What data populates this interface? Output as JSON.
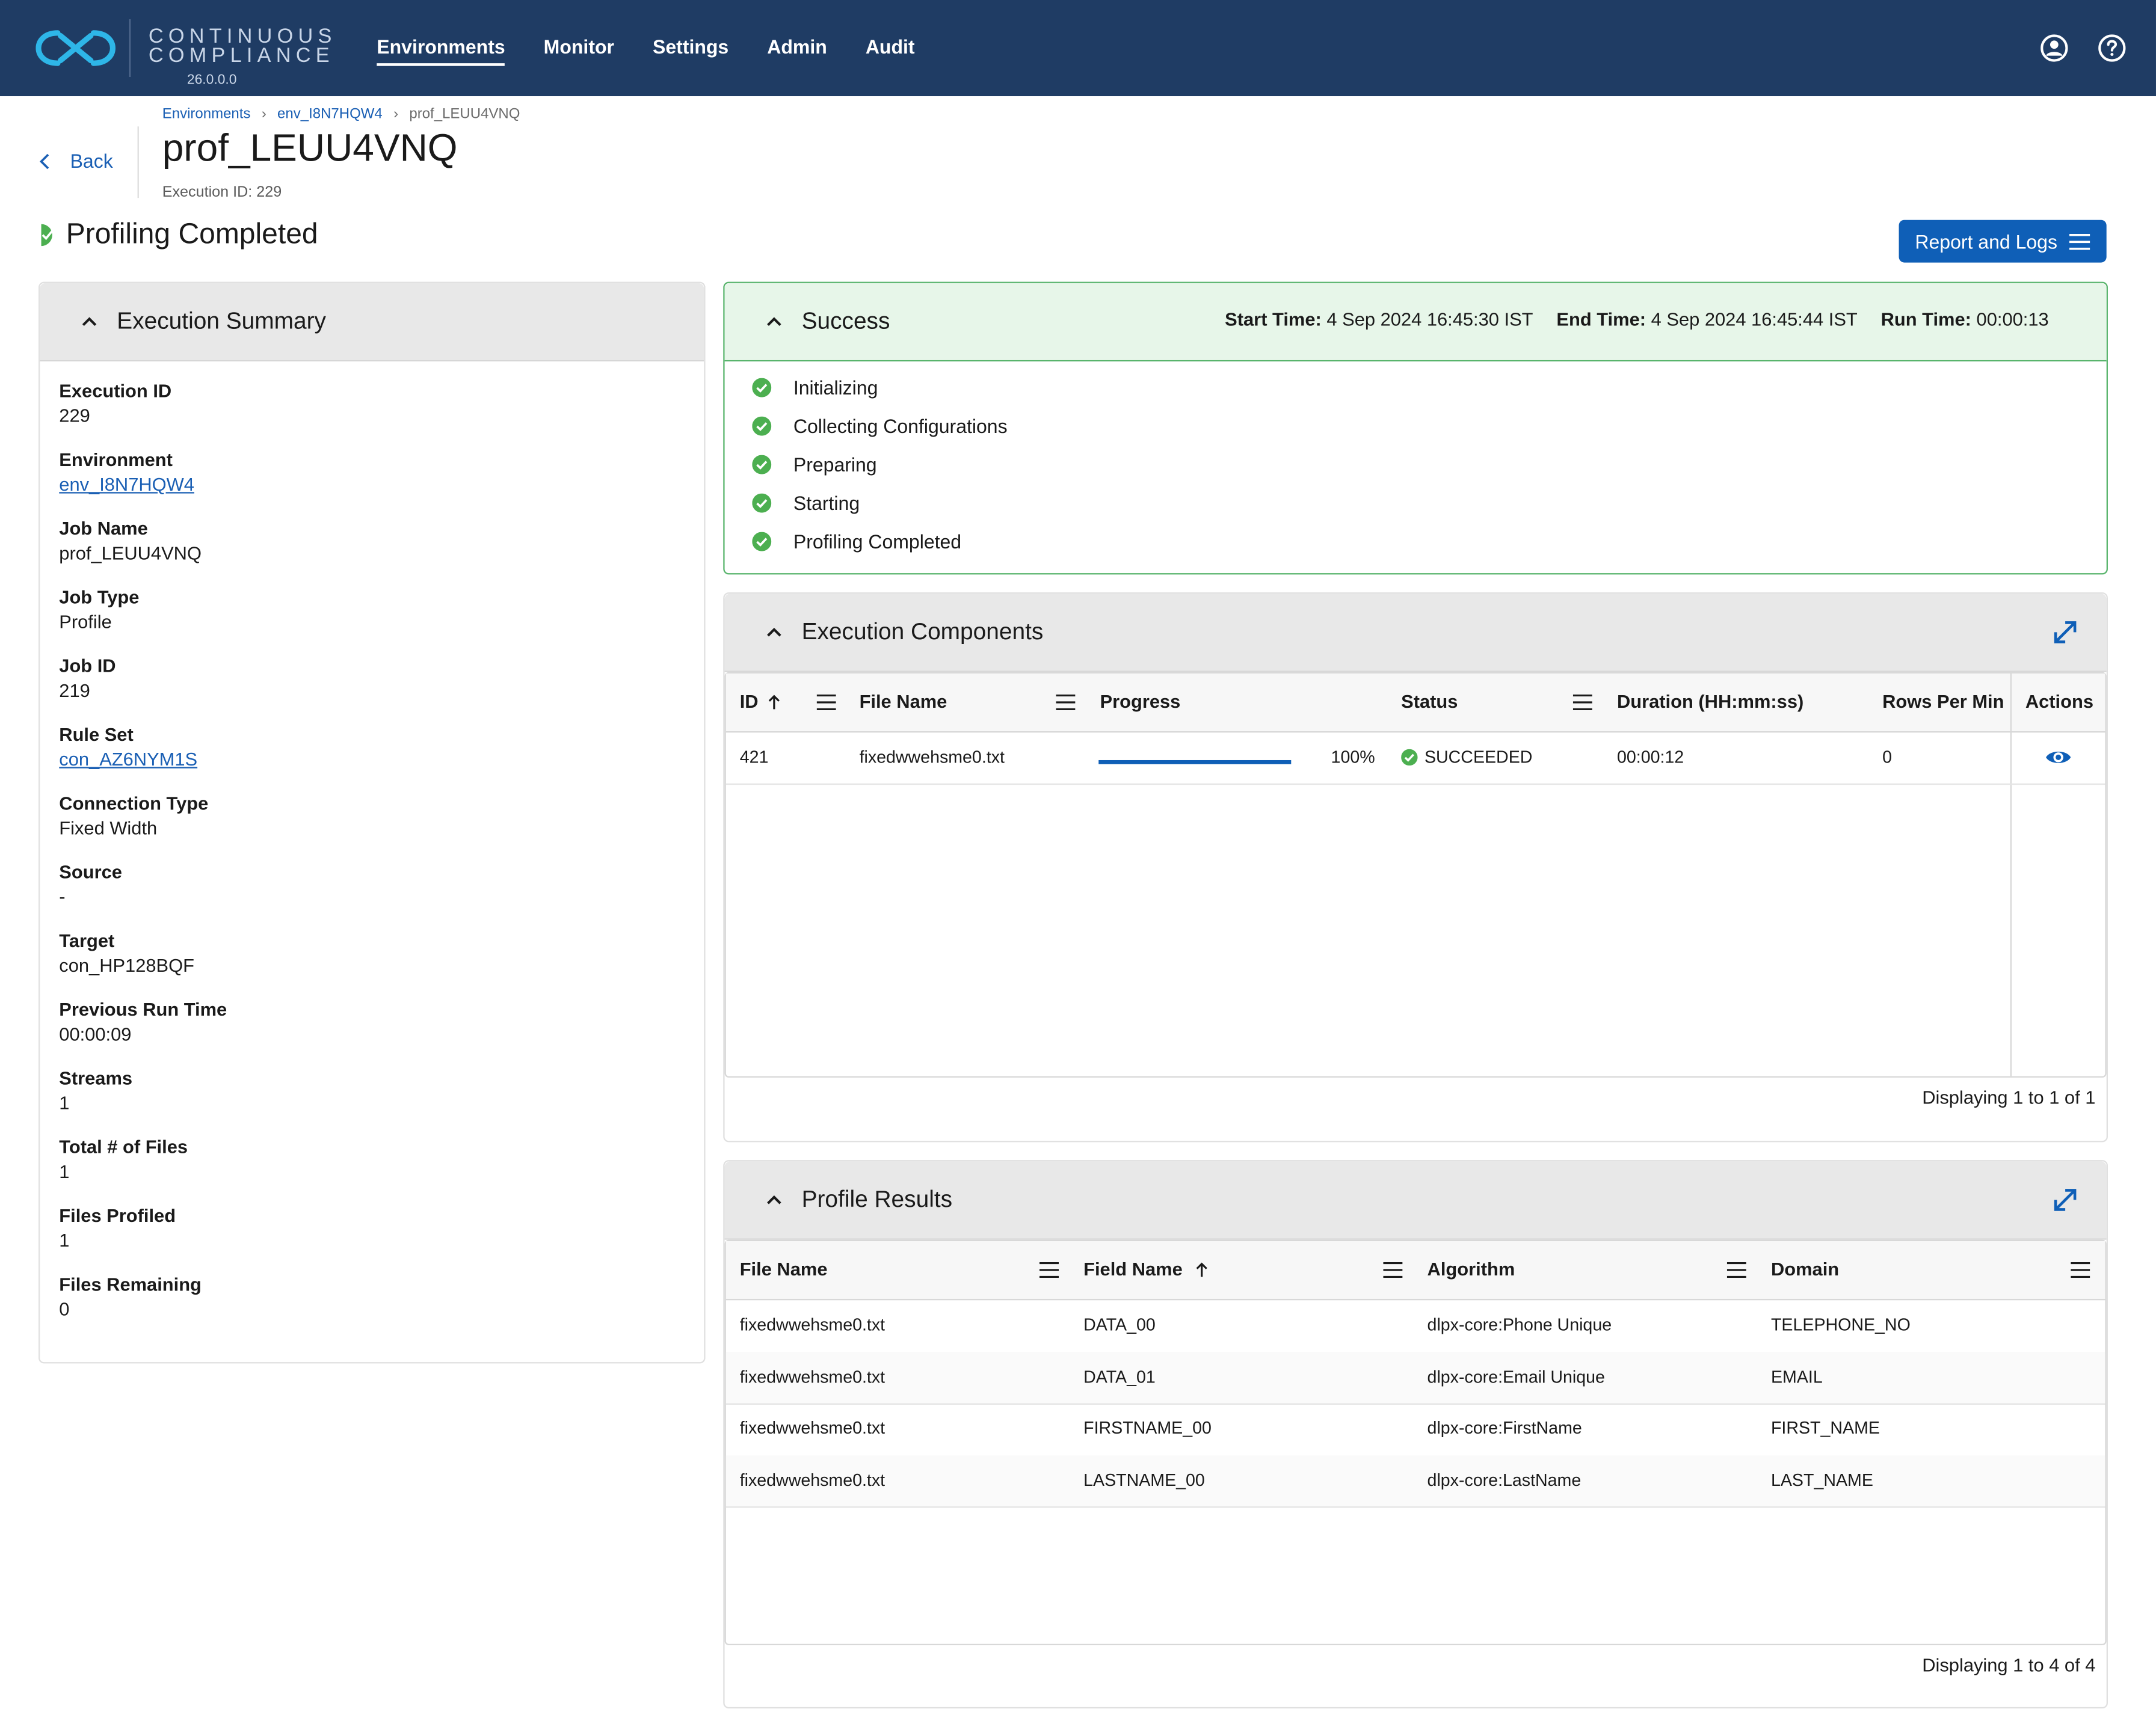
{
  "brand": {
    "line1": "CONTINUOUS",
    "line2": "COMPLIANCE",
    "version": "26.0.0.0"
  },
  "nav": {
    "items": [
      "Environments",
      "Monitor",
      "Settings",
      "Admin",
      "Audit"
    ],
    "active": "Environments"
  },
  "breadcrumb": [
    "Environments",
    "env_I8N7HQW4",
    "prof_LEUU4VNQ"
  ],
  "back_label": "Back",
  "page_title": "prof_LEUU4VNQ",
  "execution_id_sub": "Execution ID: 229",
  "status_heading": "Profiling Completed",
  "report_button": "Report and Logs",
  "summary": {
    "title": "Execution Summary",
    "fields": [
      {
        "label": "Execution ID",
        "value": "229"
      },
      {
        "label": "Environment",
        "value": "env_I8N7HQW4"
      },
      {
        "label": "Job Name",
        "value": "prof_LEUU4VNQ"
      },
      {
        "label": "Job Type",
        "value": "Profile"
      },
      {
        "label": "Job ID",
        "value": "219"
      },
      {
        "label": "Rule Set",
        "value": "con_AZ6NYM1S"
      },
      {
        "label": "Connection Type",
        "value": "Fixed Width"
      },
      {
        "label": "Source",
        "value": "-"
      },
      {
        "label": "Target",
        "value": "con_HP128BQF"
      },
      {
        "label": "Previous Run Time",
        "value": "00:00:09"
      },
      {
        "label": "Streams",
        "value": "1"
      },
      {
        "label": "Total # of Files",
        "value": "1"
      },
      {
        "label": "Files Profiled",
        "value": "1"
      },
      {
        "label": "Files Remaining",
        "value": "0"
      }
    ]
  },
  "success": {
    "title": "Success",
    "start_label": "Start Time:",
    "start_value": "4 Sep 2024 16:45:30 IST",
    "end_label": "End Time:",
    "end_value": "4 Sep 2024 16:45:44 IST",
    "run_label": "Run Time:",
    "run_value": "00:00:13",
    "steps": [
      "Initializing",
      "Collecting Configurations",
      "Preparing",
      "Starting",
      "Profiling Completed"
    ]
  },
  "components": {
    "title": "Execution Components",
    "columns": [
      "ID",
      "File Name",
      "Progress",
      "Status",
      "Duration (HH:mm:ss)",
      "Rows Per Min",
      "Actions"
    ],
    "rows": [
      {
        "id": "421",
        "file": "fixedwwehsme0.txt",
        "progress": 1.0,
        "progress_label": "100%",
        "status": "SUCCEEDED",
        "duration": "00:00:12",
        "rows_per_min": "0"
      }
    ],
    "footer": "Displaying 1 to 1 of 1"
  },
  "profile": {
    "title": "Profile Results",
    "columns": [
      "File Name",
      "Field Name",
      "Algorithm",
      "Domain"
    ],
    "rows": [
      [
        "fixedwwehsme0.txt",
        "DATA_00",
        "dlpx-core:Phone Unique",
        "TELEPHONE_NO"
      ],
      [
        "fixedwwehsme0.txt",
        "DATA_01",
        "dlpx-core:Email Unique",
        "EMAIL"
      ],
      [
        "fixedwwehsme0.txt",
        "FIRSTNAME_00",
        "dlpx-core:FirstName",
        "FIRST_NAME"
      ],
      [
        "fixedwwehsme0.txt",
        "LASTNAME_00",
        "dlpx-core:LastName",
        "LAST_NAME"
      ]
    ],
    "footer": "Displaying 1 to 4 of 4"
  },
  "colors": {
    "nav_bg": "#1f3c64",
    "accent": "#0f5fb7",
    "success": "#4caf50",
    "link": "#1a5fb4"
  }
}
